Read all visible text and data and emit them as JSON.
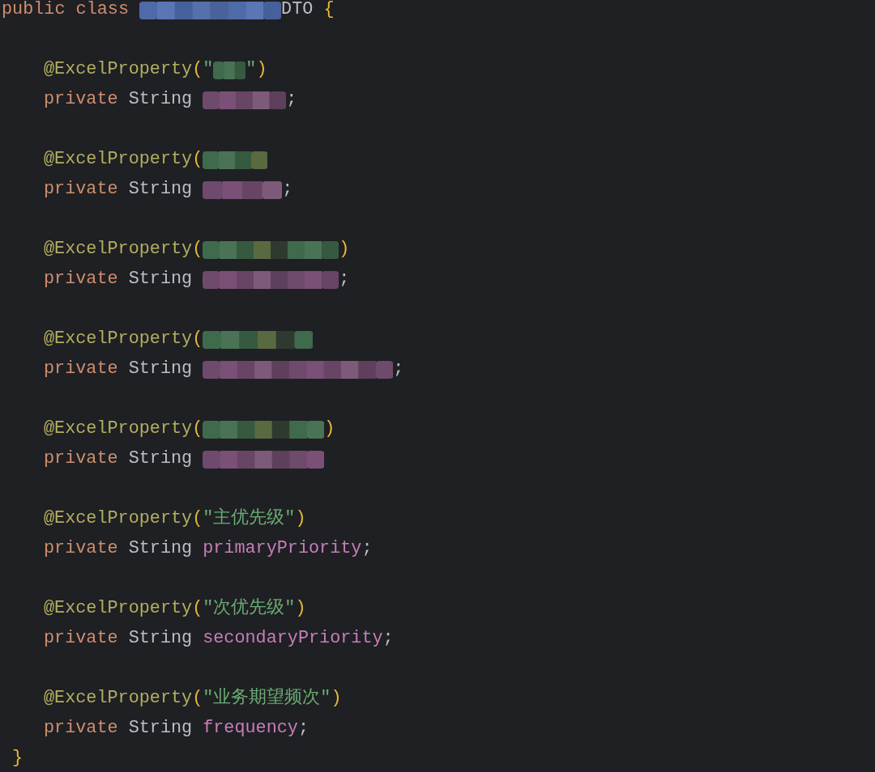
{
  "class_header": [
    {
      "kind": "keyword",
      "text": "public class"
    },
    {
      "kind": "redacted"
    },
    {
      "kind": "classname",
      "text": "DTO"
    },
    {
      "kind": "brace",
      "text": "{"
    }
  ],
  "members": [
    {
      "annotation": [
        {
          "kind": "annotation",
          "text": "@ExcelProperty"
        },
        {
          "kind": "paren",
          "text": "("
        },
        {
          "kind": "string",
          "text": "\""
        },
        {
          "kind": "redacted"
        },
        {
          "kind": "string",
          "text": "\""
        },
        {
          "kind": "paren",
          "text": ")"
        }
      ],
      "declaration": [
        {
          "kind": "keyword",
          "text": "private"
        },
        {
          "kind": "type",
          "text": "String"
        },
        {
          "kind": "redacted"
        },
        {
          "kind": "punct",
          "text": ";"
        }
      ]
    },
    {
      "annotation": [
        {
          "kind": "annotation",
          "text": "@ExcelProperty"
        },
        {
          "kind": "paren",
          "text": "("
        },
        {
          "kind": "redacted"
        }
      ],
      "declaration": [
        {
          "kind": "keyword",
          "text": "private"
        },
        {
          "kind": "type",
          "text": "String"
        },
        {
          "kind": "redacted"
        },
        {
          "kind": "punct",
          "text": ";"
        }
      ]
    },
    {
      "annotation": [
        {
          "kind": "annotation",
          "text": "@ExcelProperty"
        },
        {
          "kind": "paren",
          "text": "("
        },
        {
          "kind": "redacted"
        },
        {
          "kind": "paren",
          "text": ")"
        }
      ],
      "declaration": [
        {
          "kind": "keyword",
          "text": "private"
        },
        {
          "kind": "type",
          "text": "String"
        },
        {
          "kind": "redacted"
        },
        {
          "kind": "punct",
          "text": ";"
        }
      ]
    },
    {
      "annotation": [
        {
          "kind": "annotation",
          "text": "@ExcelProperty"
        },
        {
          "kind": "paren",
          "text": "("
        },
        {
          "kind": "redacted"
        }
      ],
      "declaration": [
        {
          "kind": "keyword",
          "text": "private"
        },
        {
          "kind": "type",
          "text": "String"
        },
        {
          "kind": "redacted"
        },
        {
          "kind": "punct",
          "text": ";"
        }
      ]
    },
    {
      "annotation": [
        {
          "kind": "annotation",
          "text": "@ExcelProperty"
        },
        {
          "kind": "paren",
          "text": "("
        },
        {
          "kind": "redacted"
        },
        {
          "kind": "paren",
          "text": ")"
        }
      ],
      "declaration": [
        {
          "kind": "keyword",
          "text": "private"
        },
        {
          "kind": "type",
          "text": "String"
        },
        {
          "kind": "redacted"
        }
      ]
    },
    {
      "annotation": [
        {
          "kind": "annotation",
          "text": "@ExcelProperty"
        },
        {
          "kind": "paren",
          "text": "("
        },
        {
          "kind": "string",
          "text": "\"主优先级\""
        },
        {
          "kind": "paren",
          "text": ")"
        }
      ],
      "declaration": [
        {
          "kind": "keyword",
          "text": "private"
        },
        {
          "kind": "type",
          "text": "String"
        },
        {
          "kind": "field",
          "text": "primaryPriority"
        },
        {
          "kind": "punct",
          "text": ";"
        }
      ]
    },
    {
      "annotation": [
        {
          "kind": "annotation",
          "text": "@ExcelProperty"
        },
        {
          "kind": "paren",
          "text": "("
        },
        {
          "kind": "string",
          "text": "\"次优先级\""
        },
        {
          "kind": "paren",
          "text": ")"
        }
      ],
      "declaration": [
        {
          "kind": "keyword",
          "text": "private"
        },
        {
          "kind": "type",
          "text": "String"
        },
        {
          "kind": "field",
          "text": "secondaryPriority"
        },
        {
          "kind": "punct",
          "text": ";"
        }
      ]
    },
    {
      "annotation": [
        {
          "kind": "annotation",
          "text": "@ExcelProperty"
        },
        {
          "kind": "paren",
          "text": "("
        },
        {
          "kind": "string",
          "text": "\"业务期望频次\""
        },
        {
          "kind": "paren",
          "text": ")"
        }
      ],
      "declaration": [
        {
          "kind": "keyword",
          "text": "private"
        },
        {
          "kind": "type",
          "text": "String"
        },
        {
          "kind": "field",
          "text": "frequency"
        },
        {
          "kind": "punct",
          "text": ";"
        }
      ]
    }
  ],
  "closing": [
    {
      "kind": "brace",
      "text": "}"
    }
  ]
}
